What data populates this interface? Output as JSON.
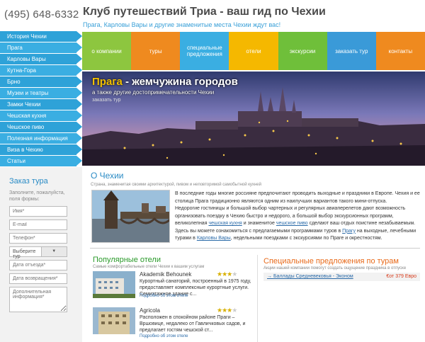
{
  "header": {
    "phone": "(495) 648-6332",
    "title": "Клуб путешествий Триа - ваш гид по Чехии",
    "subtitle": "Прага, Карловы Вары и другие знаменитые места Чехии ждут вас!"
  },
  "sidebar": {
    "items": [
      {
        "label": "История Чехии"
      },
      {
        "label": "Прага"
      },
      {
        "label": "Карловы Вары"
      },
      {
        "label": "Кутна-Гора"
      },
      {
        "label": "Брно"
      },
      {
        "label": "Музеи и театры"
      },
      {
        "label": "Замки Чехии"
      },
      {
        "label": "Чешская кухня"
      },
      {
        "label": "Чешское пиво"
      },
      {
        "label": "Полезная информация"
      },
      {
        "label": "Виза в Чехию"
      },
      {
        "label": "Статьи"
      }
    ]
  },
  "top_nav": {
    "tabs": [
      {
        "label": "о компании",
        "color": "#8dc63f"
      },
      {
        "label": "туры",
        "color": "#ef8a1f"
      },
      {
        "label": "специальные предложения",
        "color": "#3aaee2"
      },
      {
        "label": "отели",
        "color": "#f5b800"
      },
      {
        "label": "экскурсии",
        "color": "#6fbf3a"
      },
      {
        "label": "заказать тур",
        "color": "#3a9ad8"
      },
      {
        "label": "контакты",
        "color": "#ef8a1f"
      }
    ]
  },
  "hero": {
    "title_accent": "Прага",
    "title_rest": " - жемчужина городов",
    "subtitle": "а также другие достопримечательности Чехии",
    "link": "заказать тур"
  },
  "form": {
    "title": "Заказ тура",
    "note": "Заполните, пожалуйста, поля формы:",
    "name_placeholder": "Имя*",
    "email_placeholder": "E-mail",
    "phone_placeholder": "Телефон*",
    "tour_select": "Выберите тур",
    "departure_placeholder": "Дата отъезда*",
    "return_placeholder": "Дата возвращения*",
    "extra_placeholder": "Дополнительная информация*"
  },
  "about": {
    "heading": "О Чехии",
    "tagline": "Страна, знаменитая своими архитектурой, пивом и неповторимой самобытной кухней",
    "p1": "В последние годы многие россияне предпочитают проводить выходные и праздники в Европе. Чехия и ее столица Прага традиционно являются одним из наилучших вариантов такого мини-отпуска.",
    "p2a": "Недорогие гостиницы и большой выбор чартерных и регулярных авиаперелетов дают возможность организовать поездку в Чехию быстро и недорого, а большой выбор экскурсионных программ, великолепная ",
    "p2_link1": "чешская кухня",
    "p2b": " и знаменитое ",
    "p2_link2": "чешское пиво",
    "p2c": " сделают ваш отдых поистине незабываемым.",
    "p3a": "Здесь вы можете ознакомиться с предлагаемыми программами туров в ",
    "p3_link1": "Прагу",
    "p3b": " на выходные, лечебными турами в ",
    "p3_link2": "Карловы Вары",
    "p3c": ", недельными поездками с экскурсиями по Праге и окрестностям."
  },
  "hotels": {
    "heading": "Популярные отели",
    "tagline": "Самые комфортабельные отели Чехии к вашим услугам",
    "items": [
      {
        "name": "Akademik Behounek",
        "stars": 3,
        "desc": "Курортный санаторий, построенный в 1975 году, предоставляет комплексные курортные услуги. Семиэтажное здание с...",
        "more": "Подробно об этом отеле"
      },
      {
        "name": "Agricola",
        "stars": 3,
        "desc": "Расположен в спокойном районе Праги – Вршовице, недалеко от Гавличковых садов, и предлагает гостям чешской ст...",
        "more": "Подробно об этом отеле"
      }
    ]
  },
  "offers": {
    "heading": "Специальные предложения по турам",
    "tagline": "Акции нашей компании помогут создать ощущение праздника в отпуске",
    "items": [
      {
        "label": "Баллады Средневековья - Эконом",
        "price": "€от 379 Евро"
      }
    ]
  }
}
